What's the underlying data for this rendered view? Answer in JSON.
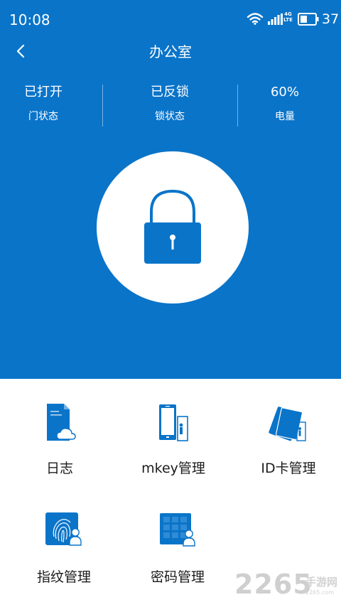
{
  "status_bar": {
    "time": "10:08",
    "network": "4G",
    "network_sub": "LTE",
    "battery": "37",
    "icons": [
      "wifi-icon",
      "signal-icon",
      "battery-icon"
    ]
  },
  "header": {
    "title": "办公室",
    "back_icon": "chevron-left-icon"
  },
  "stats": [
    {
      "value": "已打开",
      "label": "门状态"
    },
    {
      "value": "已反锁",
      "label": "锁状态"
    },
    {
      "value": "60%",
      "label": "电量"
    }
  ],
  "lock": {
    "icon": "lock-icon"
  },
  "menu": [
    {
      "label": "日志",
      "icon": "log-document-icon"
    },
    {
      "label": "mkey管理",
      "icon": "phone-key-icon"
    },
    {
      "label": "ID卡管理",
      "icon": "id-card-icon"
    },
    {
      "label": "指纹管理",
      "icon": "fingerprint-icon"
    },
    {
      "label": "密码管理",
      "icon": "keypad-icon"
    }
  ],
  "watermark": {
    "number": "2265",
    "text": "手游网",
    "url": "2265.com"
  },
  "colors": {
    "primary": "#0a74c9",
    "background": "#ffffff",
    "text": "#1c1c1c"
  }
}
